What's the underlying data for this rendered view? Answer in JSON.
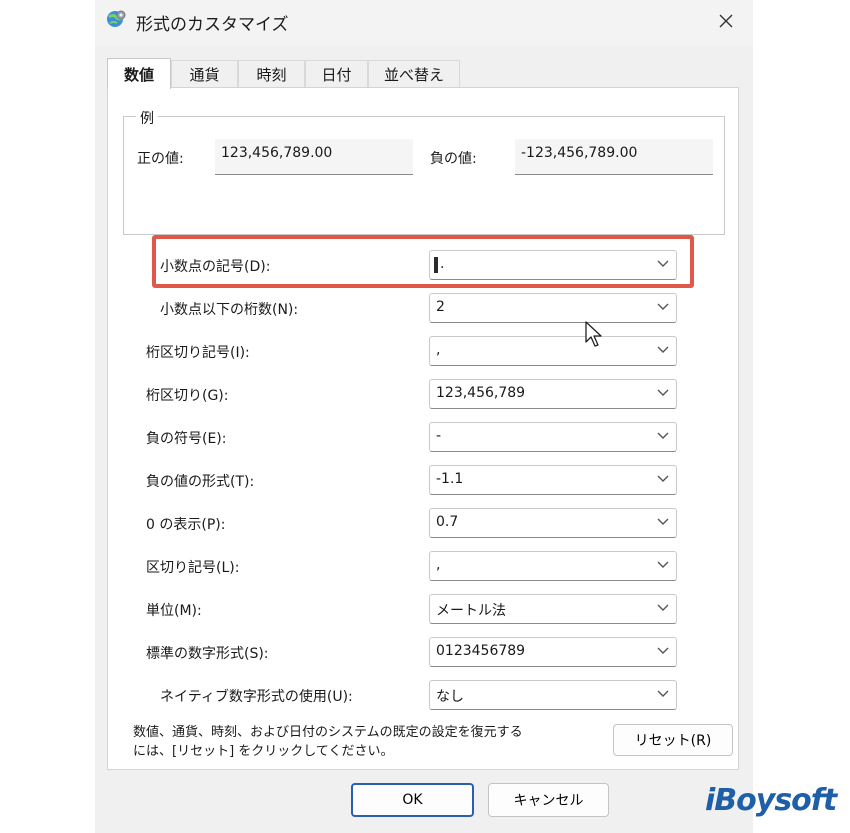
{
  "window": {
    "title": "形式のカスタマイズ"
  },
  "tabs": [
    {
      "label": "数値",
      "active": true
    },
    {
      "label": "通貨",
      "active": false
    },
    {
      "label": "時刻",
      "active": false
    },
    {
      "label": "日付",
      "active": false
    },
    {
      "label": "並べ替え",
      "active": false
    }
  ],
  "example": {
    "legend": "例",
    "positive_label": "正の値:",
    "positive_value": "123,456,789.00",
    "negative_label": "負の値:",
    "negative_value": "-123,456,789.00"
  },
  "settings": [
    {
      "label": "小数点の記号(D):",
      "value": "."
    },
    {
      "label": "小数点以下の桁数(N):",
      "value": "2"
    },
    {
      "label": "桁区切り記号(I):",
      "value": ","
    },
    {
      "label": "桁区切り(G):",
      "value": "123,456,789"
    },
    {
      "label": "負の符号(E):",
      "value": "-"
    },
    {
      "label": "負の値の形式(T):",
      "value": "-1.1"
    },
    {
      "label": "0 の表示(P):",
      "value": "0.7"
    },
    {
      "label": "区切り記号(L):",
      "value": ","
    },
    {
      "label": "単位(M):",
      "value": "メートル法"
    },
    {
      "label": "標準の数字形式(S):",
      "value": "0123456789"
    },
    {
      "label": "ネイティブ数字形式の使用(U):",
      "value": "なし"
    }
  ],
  "footer": {
    "description_line1": "数値、通貨、時刻、および日付のシステムの既定の設定を復元する",
    "description_line2": "には、[リセット] をクリックしてください。",
    "reset_label": "リセット(R)"
  },
  "buttons": {
    "ok": "OK",
    "cancel": "キャンセル"
  },
  "watermark": "iBoysoft",
  "colors": {
    "highlight": "#e0584a",
    "ok_border": "#2a5fb0",
    "logo": "#1e5fa8"
  },
  "icons": {
    "app": "globe-gear-icon",
    "close": "close-icon",
    "dropdown": "chevron-down-icon",
    "cursor": "mouse-pointer-icon"
  }
}
